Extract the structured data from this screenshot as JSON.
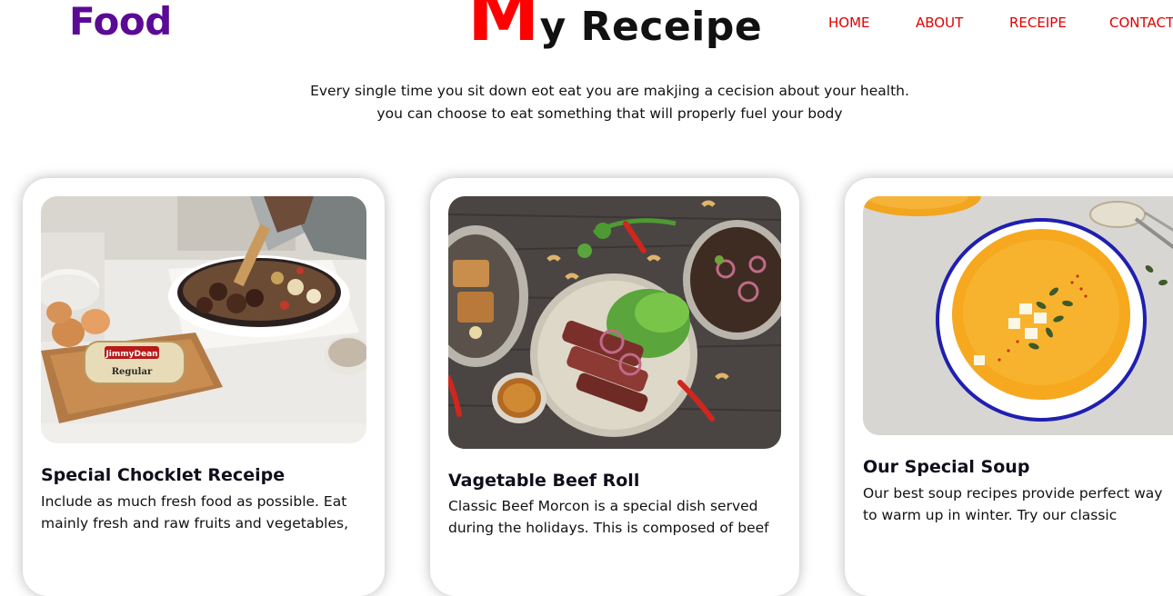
{
  "header": {
    "logo": "Food",
    "title_first_letter": "M",
    "title_rest": "y Receipe"
  },
  "nav": {
    "items": [
      "HOME",
      "ABOUT",
      "RECEIPE",
      "CONTACT"
    ]
  },
  "tagline": {
    "line1": "Every single time you sit down eot eat you are makjing a cecision about your health.",
    "line2": "you can choose to eat something that will properly fuel your body"
  },
  "cards": [
    {
      "title": "Special Chocklet Receipe",
      "text": "Include as much fresh food as possible. Eat mainly fresh and raw fruits and vegetables,"
    },
    {
      "title": "Vagetable Beef Roll",
      "text": "Classic Beef Morcon is a special dish served during the holidays. This is composed of beef"
    },
    {
      "title": "Our Special Soup",
      "text": "Our best soup recipes provide perfect way to warm up in winter. Try our classic"
    }
  ],
  "colors": {
    "logo": "#5b0a96",
    "accent_red": "#ff0000",
    "nav": "#e10000"
  }
}
